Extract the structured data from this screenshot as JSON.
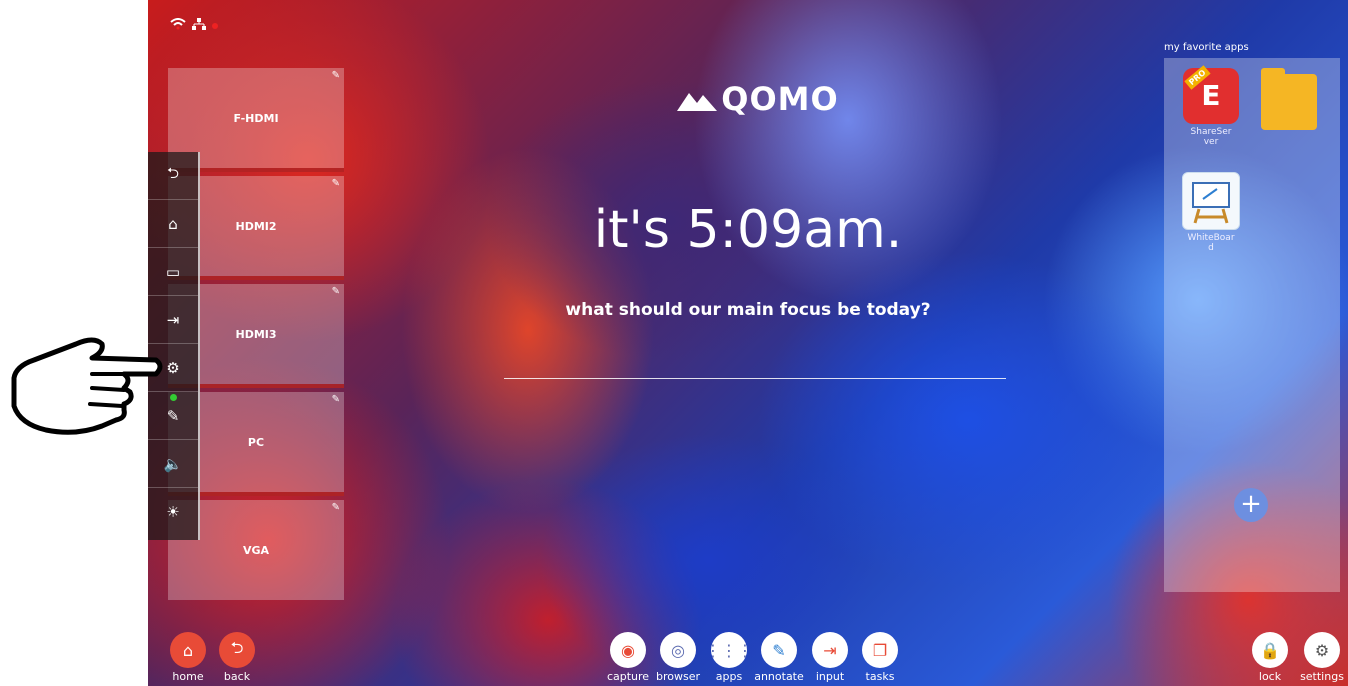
{
  "status": {
    "wifi_icon": "wifi-icon",
    "network_icon": "network-icon"
  },
  "sources": [
    {
      "label": "F-HDMI"
    },
    {
      "label": "HDMI2"
    },
    {
      "label": "HDMI3"
    },
    {
      "label": "PC"
    },
    {
      "label": "VGA"
    }
  ],
  "toolbar": [
    {
      "icon": "back-arrow-icon",
      "glyph": "⮌"
    },
    {
      "icon": "home-icon",
      "glyph": "⌂"
    },
    {
      "icon": "display-icon",
      "glyph": "▭"
    },
    {
      "icon": "input-icon",
      "glyph": "⇥"
    },
    {
      "icon": "gear-icon",
      "glyph": "⚙"
    },
    {
      "icon": "pen-icon",
      "glyph": "✎"
    },
    {
      "icon": "volume-icon",
      "glyph": "🔈"
    },
    {
      "icon": "brightness-icon",
      "glyph": "☀"
    }
  ],
  "logo": {
    "text": "QOMO"
  },
  "greeting": "it's 5:09am.",
  "question": "what should our main focus be today?",
  "focus_input": {
    "value": "",
    "placeholder": ""
  },
  "favorites": {
    "title": "my favorite apps",
    "apps": [
      {
        "name": "ShareSer\nver",
        "icon": "shareserver-icon"
      },
      {
        "name": "",
        "icon": "folder-icon"
      },
      {
        "name": "WhiteBoar\nd",
        "icon": "whiteboard-icon"
      }
    ],
    "add_icon": "plus-icon"
  },
  "bottom": {
    "home": "home",
    "back": "back",
    "capture": "capture",
    "browser": "browser",
    "apps": "apps",
    "annotate": "annotate",
    "input": "input",
    "tasks": "tasks",
    "lock": "lock",
    "settings": "settings"
  },
  "colors": {
    "accent": "#e84b37",
    "panel": "rgba(255,255,255,0.28)"
  }
}
